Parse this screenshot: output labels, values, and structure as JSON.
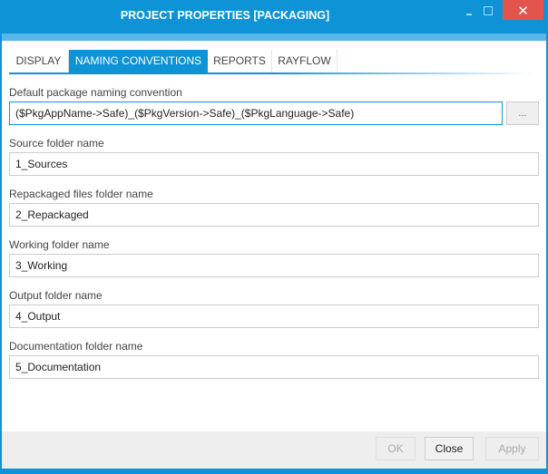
{
  "window": {
    "title": "PROJECT PROPERTIES [PACKAGING]",
    "controls": {
      "minimize": "minimize",
      "maximize": "maximize",
      "close": "✕"
    }
  },
  "tabs": [
    {
      "label": "DISPLAY",
      "active": false
    },
    {
      "label": "NAMING CONVENTIONS",
      "active": true
    },
    {
      "label": "REPORTS",
      "active": false
    },
    {
      "label": "RAYFLOW",
      "active": false
    }
  ],
  "fields": {
    "naming_convention": {
      "label": "Default package naming convention",
      "value": "($PkgAppName->Safe)_($PkgVersion->Safe)_($PkgLanguage->Safe)",
      "browse_label": "..."
    },
    "source_folder": {
      "label": "Source folder name",
      "value": "1_Sources"
    },
    "repackaged_folder": {
      "label": "Repackaged files folder name",
      "value": "2_Repackaged"
    },
    "working_folder": {
      "label": "Working folder name",
      "value": "3_Working"
    },
    "output_folder": {
      "label": "Output folder name",
      "value": "4_Output"
    },
    "documentation_folder": {
      "label": "Documentation folder name",
      "value": "5_Documentation"
    }
  },
  "footer": {
    "ok_label": "OK",
    "close_label": "Close",
    "apply_label": "Apply"
  },
  "colors": {
    "accent": "#0d93d6",
    "close_button": "#e3544c",
    "footer_bg": "#eeeeee"
  }
}
